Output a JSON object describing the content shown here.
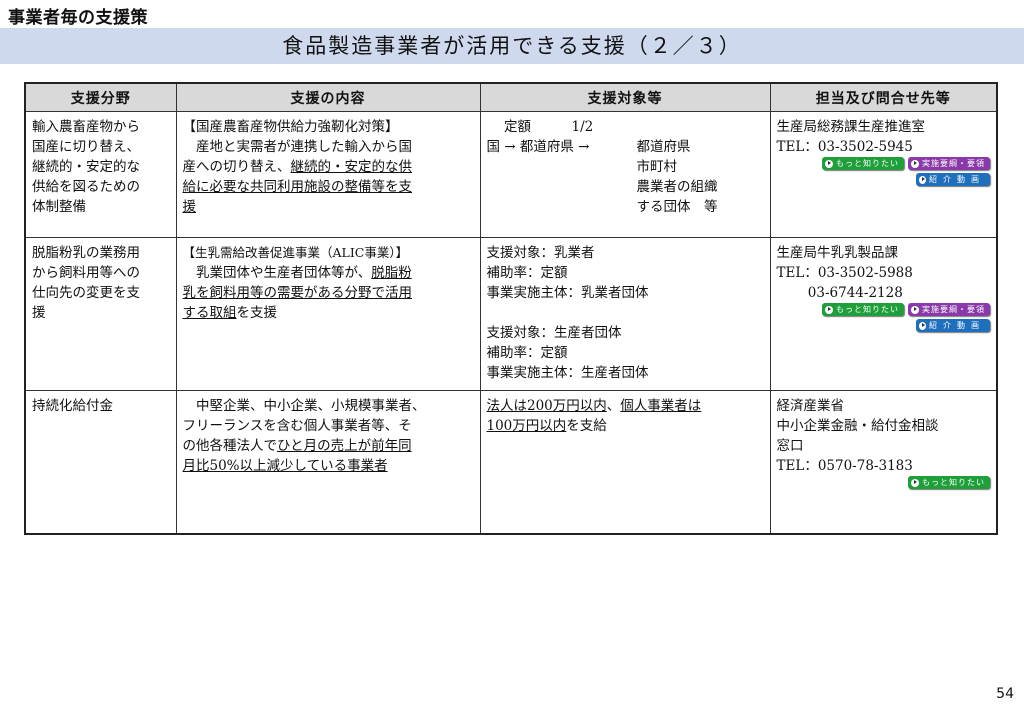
{
  "header": {
    "section_label": "事業者毎の支援策",
    "title": "食品製造事業者が活用できる支援（２／３）"
  },
  "table": {
    "columns": [
      "支援分野",
      "支援の内容",
      "支援対象等",
      "担当及び問合せ先等"
    ],
    "rows": [
      {
        "field": [
          "輸入農畜産物から",
          "国産に切り替え、",
          "継続的・安定的な",
          "供給を図るための",
          "体制整備"
        ],
        "content_title": "【国産農畜産物供給力強靭化対策】",
        "content_lines": [
          {
            "plain": "　産地と実需者が連携した輸入から国",
            "u": ""
          },
          {
            "plain": "産への切り替え、",
            "u": "継続的・安定的な供"
          },
          {
            "plain": "",
            "u": "給に必要な共同利用施設の整備等を支"
          },
          {
            "plain": "",
            "u": "援"
          }
        ],
        "target": {
          "line1": "　定額　　　1/2",
          "line2_left": "国 → 都道府県 →",
          "right_lines": [
            "都道府県",
            "市町村",
            "農業者の組織",
            "する団体　等"
          ]
        },
        "contact": [
          "生産局総務課生産推進室",
          "TEL：03-3502-5945"
        ],
        "badges": [
          [
            "もっと知りたい",
            "実施要綱・要領"
          ],
          [
            "紹介動画"
          ]
        ]
      },
      {
        "field": [
          "脱脂粉乳の業務用",
          "から飼料用等への",
          "仕向先の変更を支",
          "援"
        ],
        "content_title": "【生乳需給改善促進事業（ALIC事業）】",
        "content_lines": [
          {
            "plain": "　乳業団体や生産者団体等が、",
            "u": "脱脂粉"
          },
          {
            "plain": "",
            "u": "乳を飼料用等の需要がある分野で活用"
          },
          {
            "plain": "",
            "u": "する取組",
            "after": "を支援"
          }
        ],
        "target_lines": [
          "支援対象：乳業者",
          "補助率：定額",
          "事業実施主体：乳業者団体",
          "",
          "支援対象：生産者団体",
          "補助率：定額",
          "事業実施主体：生産者団体"
        ],
        "contact": [
          "生産局牛乳乳製品課",
          "TEL：03-3502-5988",
          "　　 03-6744-2128"
        ],
        "badges": [
          [
            "もっと知りたい",
            "実施要綱・要領"
          ],
          [
            "紹介動画"
          ]
        ]
      },
      {
        "field": [
          "持続化給付金"
        ],
        "content_lines": [
          {
            "plain": "　中堅企業、中小企業、小規模事業者、",
            "u": ""
          },
          {
            "plain": "フリーランスを含む個人事業者等、そ",
            "u": ""
          },
          {
            "plain": "の他各種法人で",
            "u": "ひと月の売上が前年同"
          },
          {
            "plain": "",
            "u": "月比50%以上減少している事業者"
          }
        ],
        "target_mixed": [
          {
            "u": "法人は200万円以内",
            "plain": "、"
          },
          {
            "u": "個人事業者は",
            "plain": ""
          },
          {
            "u": "100万円以内",
            "plain": "を支給"
          }
        ],
        "contact": [
          "経済産業省",
          "中小企業金融・給付金相談",
          "窓口",
          "TEL：0570-78-3183"
        ],
        "badges": [
          [
            "もっと知りたい"
          ]
        ]
      }
    ]
  },
  "badge_labels": {
    "more": "もっと知りたい",
    "guideline": "実施要綱・要領",
    "video": "紹介動画"
  },
  "page_number": "54"
}
